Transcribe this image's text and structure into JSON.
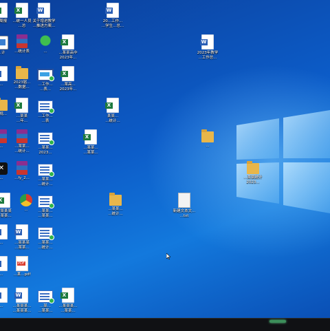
{
  "desktop": {
    "icons": [
      {
        "label": "...周报",
        "type": "excel"
      },
      {
        "label": "...统一人员\n...总",
        "type": "excel"
      },
      {
        "label": "关于增进教学\n...推进方案...",
        "type": "word"
      },
      {
        "label": "20...工作...\n...学生...总...",
        "type": "word"
      },
      {
        "label": "...计",
        "type": "app"
      },
      {
        "label": "...统计表",
        "type": "rar"
      },
      {
        "label": "...",
        "type": "leaf"
      },
      {
        "label": "...某某高中\n2023年...",
        "type": "excel"
      },
      {
        "label": "2023年教学\n...工作总...",
        "type": "word"
      },
      {
        "label": "...",
        "type": "word"
      },
      {
        "label": "2023届...\n...数据...",
        "type": "folder"
      },
      {
        "label": "...工作...\n...表...",
        "type": "shot"
      },
      {
        "label": "...某高...\n2023年...",
        "type": "excel"
      },
      {
        "label": "...规...",
        "type": "folder"
      },
      {
        "label": "...某某\n...年...",
        "type": "excel"
      },
      {
        "label": "...工作...\n...表",
        "type": "sheet"
      },
      {
        "label": "某某...\n...统计...",
        "type": "excel"
      },
      {
        "label": "...",
        "type": "rar"
      },
      {
        "label": "...某某...\n...统计...",
        "type": "rar"
      },
      {
        "label": "...某某...\n2023...",
        "type": "sheet"
      },
      {
        "label": "...某某...\n...某某...",
        "type": "excel"
      },
      {
        "label": "...",
        "type": "folder"
      },
      {
        "label": "...",
        "type": "dark"
      },
      {
        "label": "...fy_2...",
        "type": "rar"
      },
      {
        "label": "...某某...\n...统计...",
        "type": "sheet"
      },
      {
        "label": "...某某统计\n2023...",
        "type": "folder"
      },
      {
        "label": "...",
        "type": "folder"
      },
      {
        "label": "...某某某\n...某某...",
        "type": "excel"
      },
      {
        "label": "...",
        "type": "chrome"
      },
      {
        "label": "...某某...\n...某某...",
        "type": "sheet"
      },
      {
        "label": "...某某...\n...统计...",
        "type": "folder"
      },
      {
        "label": "新建文本文...\n...txt",
        "type": "txt"
      },
      {
        "label": "...",
        "type": "word"
      },
      {
        "label": "...某某某\n...某某...",
        "type": "word"
      },
      {
        "label": "...某某...\n...统计...",
        "type": "sheet"
      },
      {
        "label": "...",
        "type": "word"
      },
      {
        "label": "...某...pdf",
        "type": "pdfred"
      },
      {
        "label": "...",
        "type": "word"
      },
      {
        "label": "...某某某...\n...某某某...",
        "type": "word"
      },
      {
        "label": "...某...\n...某某...",
        "type": "sheet"
      },
      {
        "label": "...某某某...\n...某某...",
        "type": "excel"
      }
    ]
  },
  "taskbar": {
    "indicator_color": "#3c8f5a"
  },
  "colors": {
    "wallpaper_accent": "#1379dd",
    "excel": "#1d7a3f",
    "word": "#2b5fb5"
  }
}
